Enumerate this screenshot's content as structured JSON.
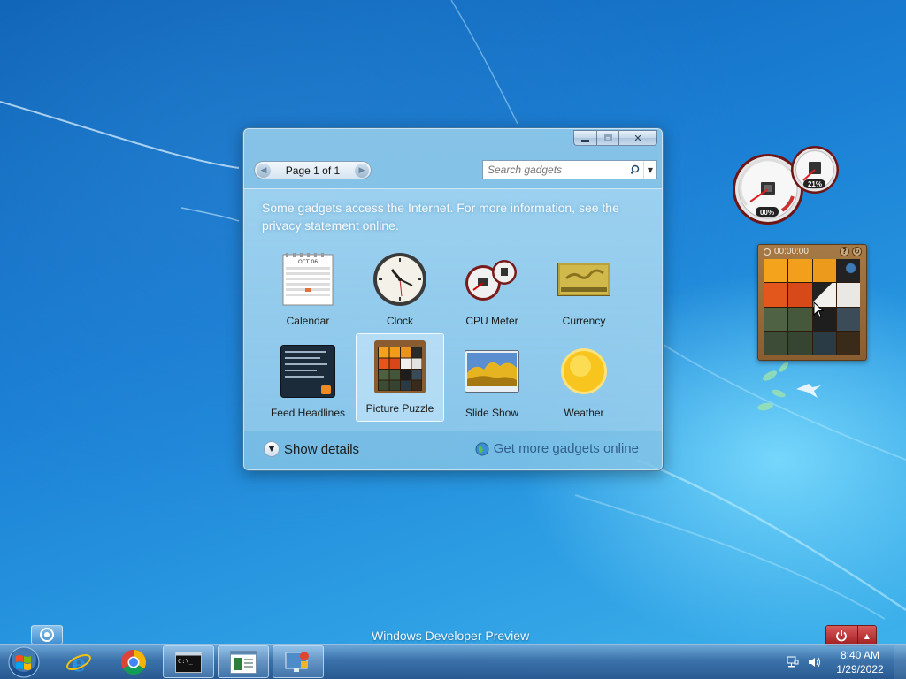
{
  "gallery": {
    "window_controls": {
      "minimize": "minimize",
      "maximize": "maximize",
      "close": "✕"
    },
    "pager": {
      "label": "Page 1 of 1",
      "prev": "◀",
      "next": "▶"
    },
    "search": {
      "placeholder": "Search gadgets"
    },
    "notice": "Some gadgets access the Internet.  For more information, see the privacy statement online.",
    "gadgets": [
      {
        "name": "Calendar",
        "icon": "calendar-icon"
      },
      {
        "name": "Clock",
        "icon": "clock-icon"
      },
      {
        "name": "CPU Meter",
        "icon": "cpu-meter-icon"
      },
      {
        "name": "Currency",
        "icon": "currency-icon"
      },
      {
        "name": "Feed Headlines",
        "icon": "feed-headlines-icon"
      },
      {
        "name": "Picture Puzzle",
        "icon": "picture-puzzle-icon",
        "selected": true
      },
      {
        "name": "Slide Show",
        "icon": "slide-show-icon"
      },
      {
        "name": "Weather",
        "icon": "weather-icon"
      }
    ],
    "calendar_month": "OCT 06",
    "footer": {
      "show_details": "Show details",
      "get_more": "Get more gadgets online"
    }
  },
  "cpu_meter": {
    "cpu_percent": "00%",
    "memory_percent": "21%"
  },
  "puzzle_gadget": {
    "timer": "00:00:00"
  },
  "desktop": {
    "watermark": "Windows Developer Preview"
  },
  "taskbar": {
    "clock_time": "8:40 AM",
    "clock_date": "1/29/2022",
    "buttons": [
      "Internet Explorer",
      "Google Chrome",
      "Command Prompt",
      "Notepad",
      "Desktop Gadget Gallery"
    ]
  },
  "colors": {
    "accent": "#1a7fd4",
    "shutdown": "#a01d1e"
  }
}
